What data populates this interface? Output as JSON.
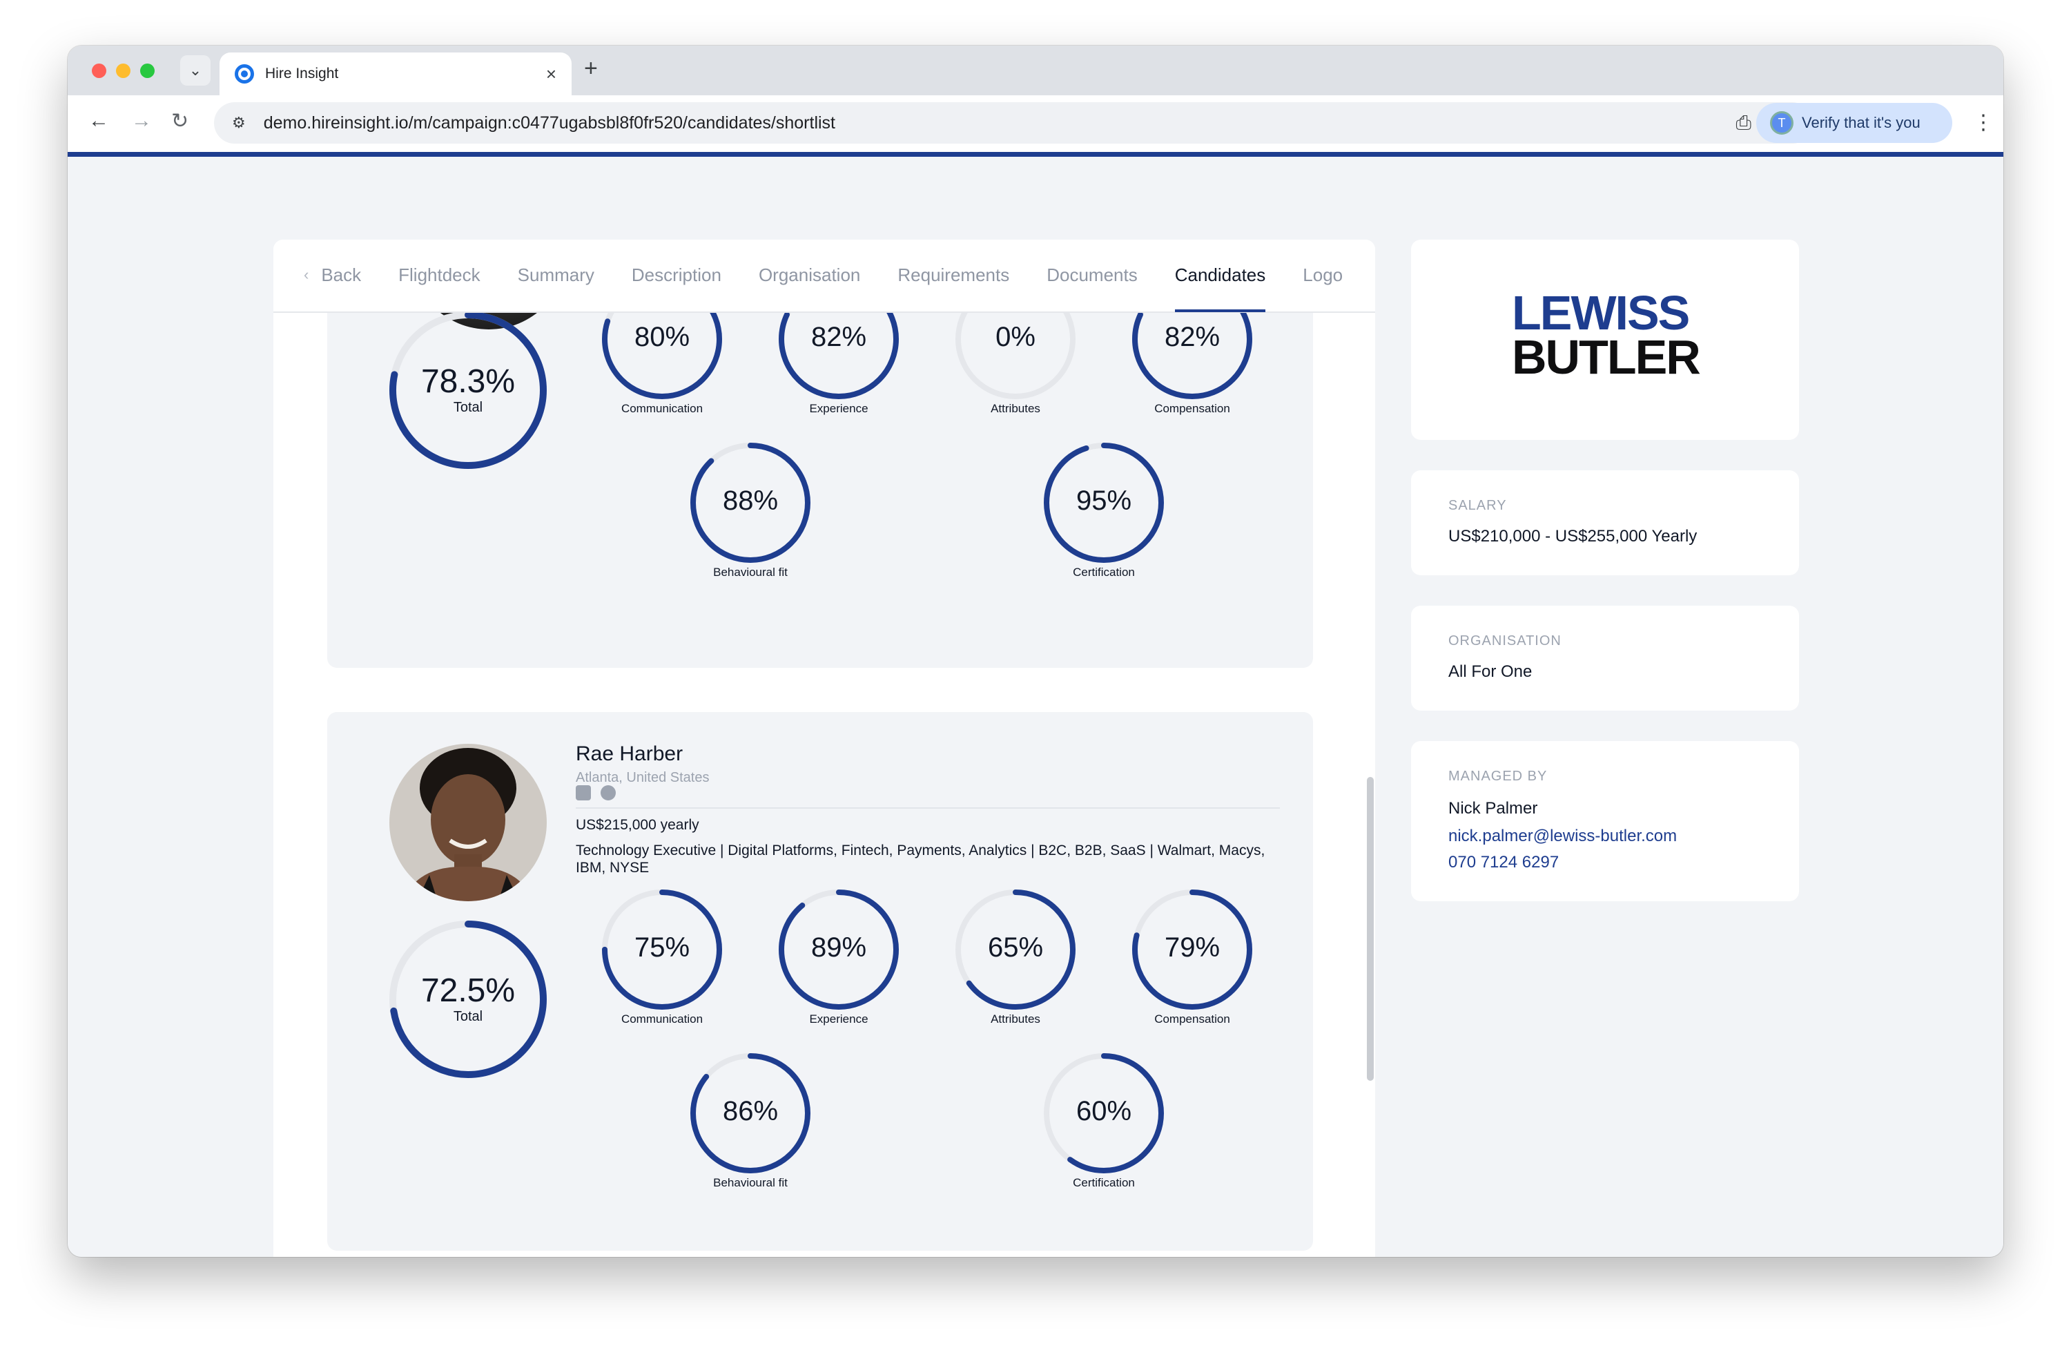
{
  "browser": {
    "tab_title": "Hire Insight",
    "url": "demo.hireinsight.io/m/campaign:c0477ugabsbl8f0fr520/candidates/shortlist",
    "verify_label": "Verify that it's you",
    "verify_avatar_initial": "T"
  },
  "nav": {
    "back_label": "Back",
    "tabs": [
      "Flightdeck",
      "Summary",
      "Description",
      "Organisation",
      "Requirements",
      "Documents",
      "Candidates",
      "Logo"
    ],
    "active_tab": "Candidates"
  },
  "candidates": [
    {
      "total": {
        "value": 78.3,
        "text": "78.3%",
        "label": "Total"
      },
      "scores": [
        {
          "label": "Communication",
          "value": 80,
          "text": "80%"
        },
        {
          "label": "Experience",
          "value": 82,
          "text": "82%"
        },
        {
          "label": "Attributes",
          "value": 0,
          "text": "0%"
        },
        {
          "label": "Compensation",
          "value": 82,
          "text": "82%"
        },
        {
          "label": "Behavioural fit",
          "value": 88,
          "text": "88%"
        },
        {
          "label": "Certification",
          "value": 95,
          "text": "95%"
        }
      ]
    },
    {
      "name": "Rae Harber",
      "location": "Atlanta, United States",
      "salary": "US$215,000 yearly",
      "headline": "Technology Executive | Digital Platforms, Fintech, Payments, Analytics | B2C, B2B, SaaS | Walmart, Macys, IBM, NYSE",
      "social_icons": [
        "linkedin-icon",
        "facebook-icon"
      ],
      "total": {
        "value": 72.5,
        "text": "72.5%",
        "label": "Total"
      },
      "scores": [
        {
          "label": "Communication",
          "value": 75,
          "text": "75%"
        },
        {
          "label": "Experience",
          "value": 89,
          "text": "89%"
        },
        {
          "label": "Attributes",
          "value": 65,
          "text": "65%"
        },
        {
          "label": "Compensation",
          "value": 79,
          "text": "79%"
        },
        {
          "label": "Behavioural fit",
          "value": 86,
          "text": "86%"
        },
        {
          "label": "Certification",
          "value": 60,
          "text": "60%"
        }
      ]
    }
  ],
  "sidebar": {
    "logo_line1": "LEWISS",
    "logo_line2": "BUTLER",
    "salary_label": "SALARY",
    "salary_value": "US$210,000 - US$255,000 Yearly",
    "org_label": "ORGANISATION",
    "org_value": "All For One",
    "managed_label": "MANAGED BY",
    "manager_name": "Nick Palmer",
    "manager_email": "nick.palmer@lewiss-butler.com",
    "manager_phone": "070 7124 6297"
  },
  "colors": {
    "accent": "#1e3d8f",
    "ring_track": "#e5e7eb"
  }
}
